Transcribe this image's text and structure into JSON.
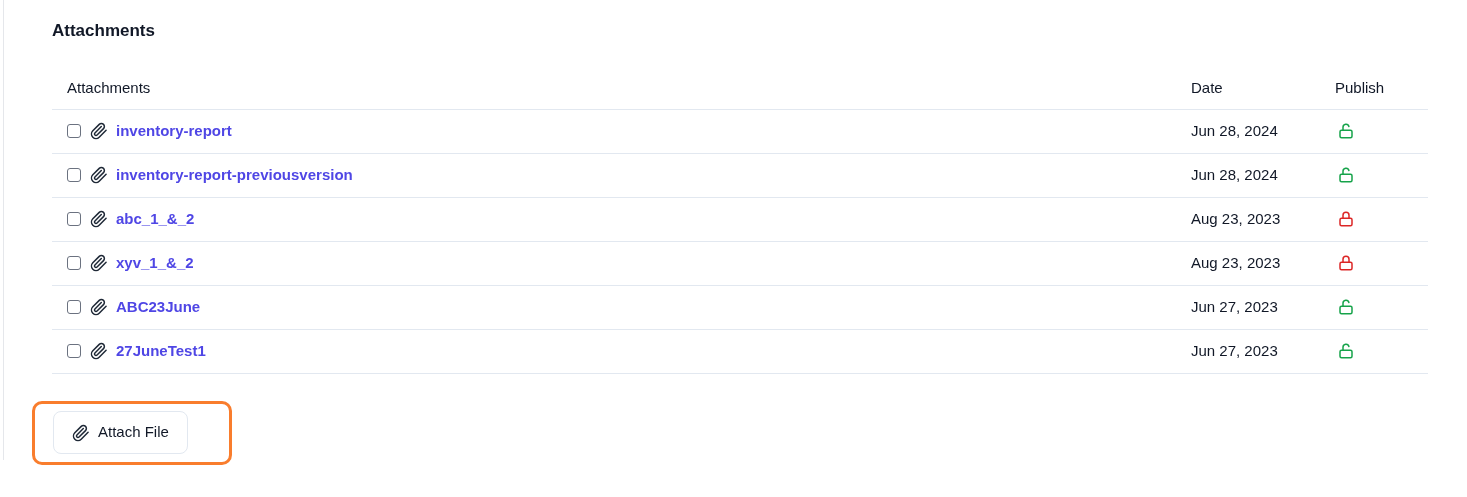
{
  "section_title": "Attachments",
  "table": {
    "columns": [
      "Attachments",
      "Date",
      "Publish"
    ],
    "rows": [
      {
        "name": "inventory-report",
        "date": "Jun 28, 2024",
        "checked": false,
        "published": true
      },
      {
        "name": "inventory-report-previousversion",
        "date": "Jun 28, 2024",
        "checked": false,
        "published": true
      },
      {
        "name": "abc_1_&_2",
        "date": "Aug 23, 2023",
        "checked": false,
        "published": false
      },
      {
        "name": "xyv_1_&_2",
        "date": "Aug 23, 2023",
        "checked": false,
        "published": false
      },
      {
        "name": "ABC23June",
        "date": "Jun 27, 2023",
        "checked": false,
        "published": true
      },
      {
        "name": "27JuneTest1",
        "date": "Jun 27, 2023",
        "checked": false,
        "published": true
      }
    ]
  },
  "attach_button": {
    "label": "Attach File",
    "highlighted": true
  }
}
